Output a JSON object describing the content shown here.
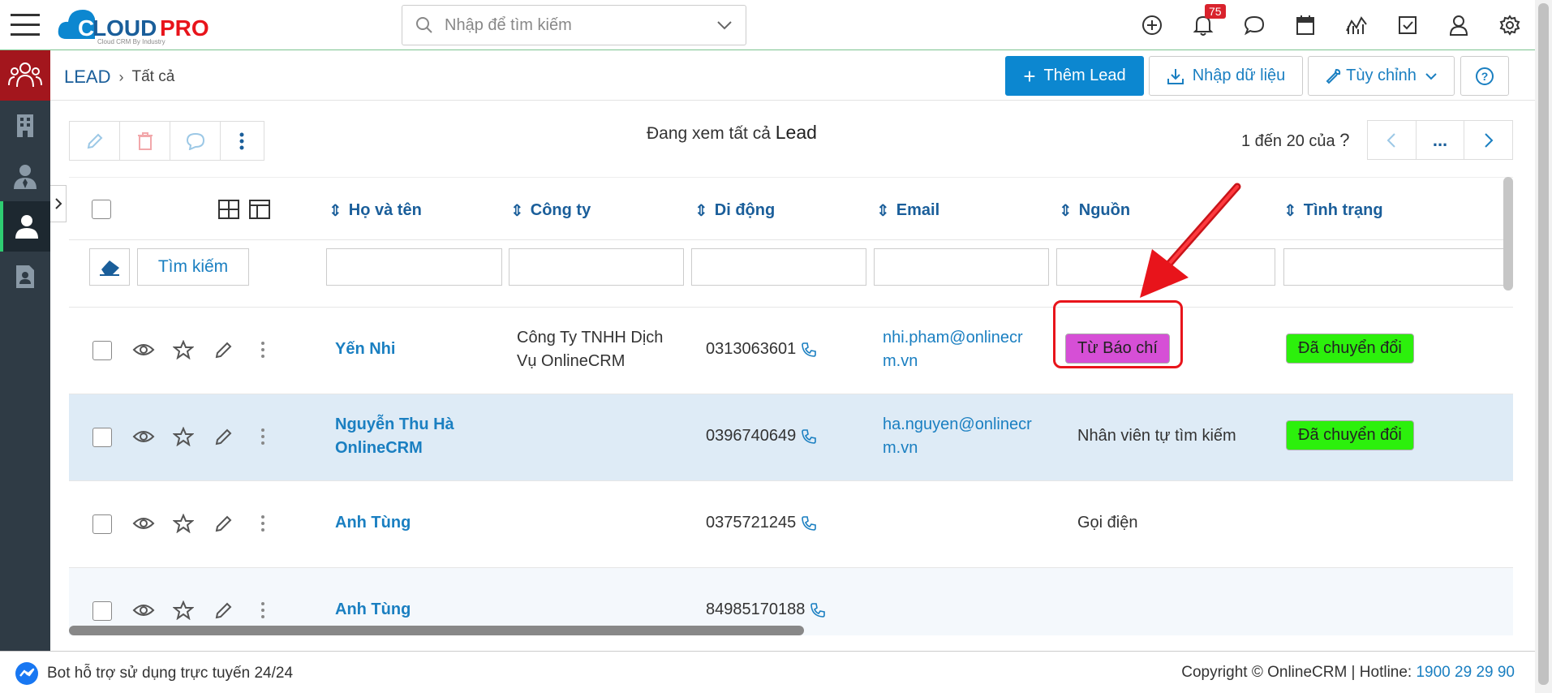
{
  "header": {
    "logo_text": "CLOUDPRO",
    "logo_tagline": "Cloud CRM By Industry",
    "search_placeholder": "Nhập để tìm kiếm",
    "notification_count": "75"
  },
  "breadcrumb": {
    "module": "LEAD",
    "view": "Tất cả"
  },
  "actions": {
    "add": "Thêm Lead",
    "import": "Nhập dữ liệu",
    "customize": "Tùy chỉnh"
  },
  "list": {
    "viewing_prefix": "Đang xem tất cả",
    "viewing_entity": "Lead",
    "paging": "1 đến 20 của",
    "paging_unknown": "?",
    "pager_more": "..."
  },
  "columns": [
    "Họ và tên",
    "Công ty",
    "Di động",
    "Email",
    "Nguồn",
    "Tình trạng"
  ],
  "filter": {
    "search_button": "Tìm kiếm"
  },
  "rows": [
    {
      "name_1": "Yến Nhi",
      "name_2": "",
      "company_1": "Công Ty TNHH Dịch",
      "company_2": "Vụ OnlineCRM",
      "phone": "0313063601",
      "email_1": "nhi.pham@onlinecr",
      "email_2": "m.vn",
      "source": "Từ Báo chí",
      "status": "Đã chuyển đổi"
    },
    {
      "name_1": "Nguyễn Thu Hà",
      "name_2": "OnlineCRM",
      "company_1": "",
      "company_2": "",
      "phone": "0396740649",
      "email_1": "ha.nguyen@onlinecr",
      "email_2": "m.vn",
      "source": "Nhân viên tự tìm kiếm",
      "status": "Đã chuyển đổi"
    },
    {
      "name_1": "Anh Tùng",
      "name_2": "",
      "company_1": "",
      "company_2": "",
      "phone": "0375721245",
      "email_1": "",
      "email_2": "",
      "source": "Gọi điện",
      "status": ""
    },
    {
      "name_1": "Anh Tùng",
      "name_2": "",
      "company_1": "",
      "company_2": "",
      "phone": "84985170188",
      "email_1": "",
      "email_2": "",
      "source": "",
      "status": ""
    }
  ],
  "colors": {
    "source_tag": "#d64fd6",
    "status_tag": "#2cf00c",
    "primary": "#0c87d0",
    "sidebar": "#2f3b45",
    "annotation": "#e8141b"
  },
  "footer": {
    "bot": "Bot hỗ trợ sử dụng trực tuyến 24/24",
    "copyright": "Copyright © OnlineCRM | Hotline: ",
    "hotline": "1900 29 29 90"
  }
}
